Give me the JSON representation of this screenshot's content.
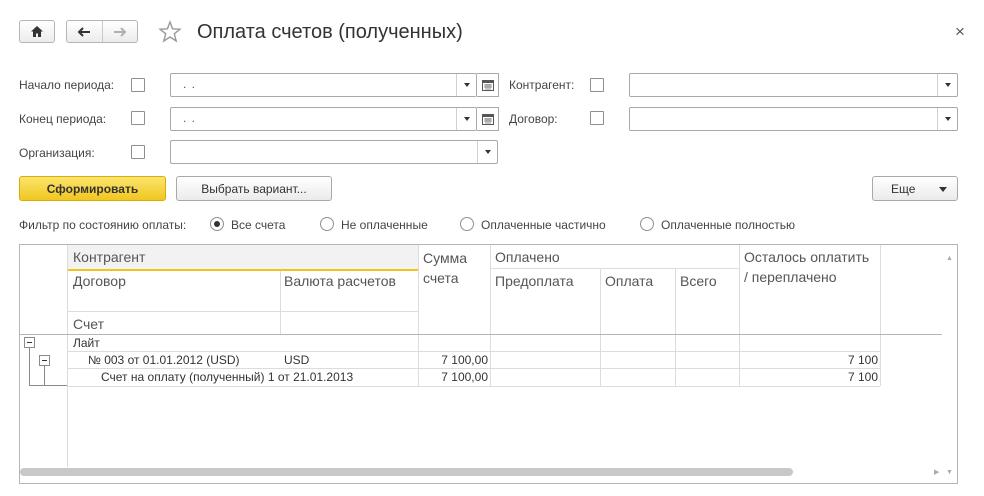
{
  "window": {
    "title": "Оплата счетов (полученных)",
    "close_glyph": "×"
  },
  "icons": {
    "home": "home-icon",
    "back": "arrow-left-icon",
    "forward": "arrow-right-icon",
    "favorite": "star-icon",
    "close": "close-icon",
    "calendar": "calendar-icon",
    "dropdown": "chevron-down-icon"
  },
  "filters": {
    "period_start_label": "Начало периода:",
    "period_start_value": ". .",
    "period_end_label": "Конец периода:",
    "period_end_value": ". .",
    "organization_label": "Организация:",
    "organization_value": "",
    "counterparty_label": "Контрагент:",
    "counterparty_value": "",
    "contract_label": "Договор:",
    "contract_value": ""
  },
  "toolbar": {
    "generate_label": "Сформировать",
    "variant_label": "Выбрать вариант...",
    "more_label": "Еще"
  },
  "payment_filter": {
    "label": "Фильтр по состоянию оплаты:",
    "options": [
      "Все счета",
      "Не оплаченные",
      "Оплаченные частично",
      "Оплаченные полностью"
    ],
    "selected": "Все счета"
  },
  "table": {
    "headers": {
      "counterparty": "Контрагент",
      "contract": "Договор",
      "currency": "Валюта расчетов",
      "invoice": "Счет",
      "invoice_sum": "Сумма счета",
      "paid": "Оплачено",
      "prepayment": "Предоплата",
      "payment": "Оплата",
      "total": "Всего",
      "remaining": "Осталось оплатить / переплачено"
    },
    "rows": [
      {
        "name": "Лайт",
        "currency": "",
        "sum": "",
        "remaining": ""
      },
      {
        "name": "№ 003 от 01.01.2012 (USD)",
        "currency": "USD",
        "sum": "7 100,00",
        "remaining": "7 100"
      },
      {
        "name": "Счет на оплату (полученный) 1 от 21.01.2013",
        "currency": "",
        "sum": "7 100,00",
        "remaining": "7 100"
      }
    ]
  },
  "colors": {
    "primary_button": "#f1c61f",
    "header_highlight": "#f2f2f2",
    "focus_underline": "#f0c419"
  }
}
